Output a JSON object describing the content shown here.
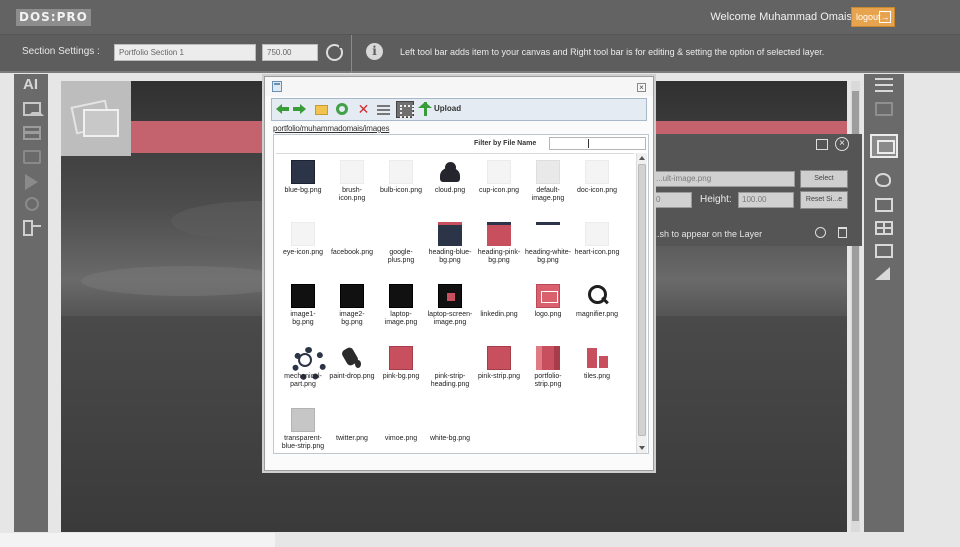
{
  "app": {
    "logo_text": "DOS:PRO",
    "welcome_text": "Welcome Muhammad Omais",
    "logout_label": "logout"
  },
  "settings": {
    "label": "Section Settings :",
    "section_name": "Portfolio Section 1",
    "section_height": "750.00",
    "info_text": "Left tool bar adds item to your canvas and Right tool bar is for editing & setting the option of selected layer."
  },
  "left_toolbar": {
    "ai_label": "AI"
  },
  "properties_panel": {
    "source_value": "...ult-image.png",
    "width_value": "0",
    "height_label": "Height:",
    "height_value": "100.00",
    "select_button": "Select",
    "reset_button": "Reset Si...e",
    "hint_text": "...sh to appear on the Layer"
  },
  "file_browser": {
    "toolbar": {
      "upload_label": "Upload"
    },
    "path": "portfolio/muhammadomais/images",
    "filter_label": "Filter by File Name",
    "filter_value": "",
    "files": [
      {
        "name": "blue-bg.png",
        "thumb": "navy"
      },
      {
        "name": "brush-icon.png",
        "thumb": "faint"
      },
      {
        "name": "bulb-icon.png",
        "thumb": "faint"
      },
      {
        "name": "cloud.png",
        "thumb": "cloud"
      },
      {
        "name": "cup-icon.png",
        "thumb": "faint"
      },
      {
        "name": "default-image.png",
        "thumb": "faint2"
      },
      {
        "name": "doc-icon.png",
        "thumb": "faint"
      },
      {
        "name": "eye-icon.png",
        "thumb": "faint"
      },
      {
        "name": "facebook.png",
        "thumb": "white"
      },
      {
        "name": "google-plus.png",
        "thumb": "white"
      },
      {
        "name": "heading-blue-bg.png",
        "thumb": "heading-blue"
      },
      {
        "name": "heading-pink-bg.png",
        "thumb": "heading-pink"
      },
      {
        "name": "heading-white-bg.png",
        "thumb": "heading-white"
      },
      {
        "name": "heart-icon.png",
        "thumb": "faint"
      },
      {
        "name": "image1-bg.png",
        "thumb": "black"
      },
      {
        "name": "image2-bg.png",
        "thumb": "black"
      },
      {
        "name": "laptop-image.png",
        "thumb": "black"
      },
      {
        "name": "laptop-screen-image.png",
        "thumb": "laptop-screen"
      },
      {
        "name": "linkedin.png",
        "thumb": "white"
      },
      {
        "name": "logo.png",
        "thumb": "logo"
      },
      {
        "name": "magnifier.png",
        "thumb": "magnifier"
      },
      {
        "name": "mechanical-part.png",
        "thumb": "gear"
      },
      {
        "name": "paint-drop.png",
        "thumb": "paint"
      },
      {
        "name": "pink-bg.png",
        "thumb": "pink"
      },
      {
        "name": "pink-strip-heading.png",
        "thumb": "white"
      },
      {
        "name": "pink-strip.png",
        "thumb": "pink"
      },
      {
        "name": "portfolio-strip.png",
        "thumb": "portfolio"
      },
      {
        "name": "tiles.png",
        "thumb": "tiles"
      },
      {
        "name": "transparent-blue-strip.png",
        "thumb": "grey"
      },
      {
        "name": "twitter.png",
        "thumb": "white"
      },
      {
        "name": "vimoe.png",
        "thumb": "white"
      },
      {
        "name": "white-bg.png",
        "thumb": "white"
      }
    ]
  }
}
